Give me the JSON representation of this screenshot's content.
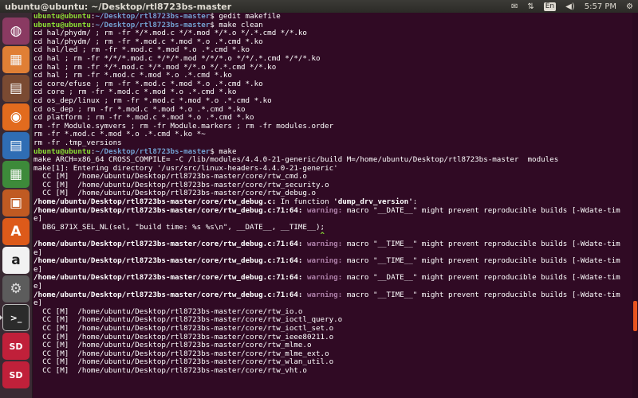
{
  "window": {
    "title": "ubuntu@ubuntu: ~/Desktop/rtl8723bs-master"
  },
  "panel": {
    "keyboard_layout": "En",
    "time": "5:57 PM"
  },
  "launcher": {
    "items": [
      {
        "name": "dash-home-icon",
        "color": "#ffffff",
        "bg": "#8a3a62",
        "glyph": "◍"
      },
      {
        "name": "system-installer-icon",
        "color": "#f6f6f6",
        "bg": "#e07f35",
        "glyph": "▦"
      },
      {
        "name": "files-icon",
        "color": "#ffffff",
        "bg": "#7a4a32",
        "glyph": "▤"
      },
      {
        "name": "firefox-icon",
        "color": "#ffffff",
        "bg": "#e26b1e",
        "glyph": "◉"
      },
      {
        "name": "libreoffice-writer-icon",
        "color": "#ffffff",
        "bg": "#2f6db4",
        "glyph": "▤"
      },
      {
        "name": "libreoffice-calc-icon",
        "color": "#ffffff",
        "bg": "#3d8a3a",
        "glyph": "▦"
      },
      {
        "name": "libreoffice-impress-icon",
        "color": "#ffffff",
        "bg": "#c05a22",
        "glyph": "▣"
      },
      {
        "name": "ubuntu-software-icon",
        "color": "#ffffff",
        "bg": "#dd5a1a",
        "glyph": "A"
      },
      {
        "name": "amazon-icon",
        "color": "#222222",
        "bg": "#f2f2f2",
        "glyph": "a"
      },
      {
        "name": "system-settings-icon",
        "color": "#dddddd",
        "bg": "#5c5c5c",
        "glyph": "⚙"
      },
      {
        "name": "terminal-icon",
        "color": "#ffffff",
        "bg": "#2b2b2b",
        "glyph": ">_"
      },
      {
        "name": "sd-card-icon",
        "color": "#ffffff",
        "bg": "#c0203a",
        "glyph": "SD"
      },
      {
        "name": "sd-card-icon-2",
        "color": "#ffffff",
        "bg": "#c0203a",
        "glyph": "SD"
      }
    ],
    "active_index": 10
  },
  "terminal": {
    "lines": [
      [
        {
          "t": "ubuntu@ubuntu",
          "c": "prompt"
        },
        {
          "t": ":",
          "c": ""
        },
        {
          "t": "~/Desktop/rtl8723bs-master",
          "c": "path"
        },
        {
          "t": "$ gedit makefile",
          "c": ""
        }
      ],
      [
        {
          "t": "ubuntu@ubuntu",
          "c": "prompt"
        },
        {
          "t": ":",
          "c": ""
        },
        {
          "t": "~/Desktop/rtl8723bs-master",
          "c": "path"
        },
        {
          "t": "$ make clean",
          "c": ""
        }
      ],
      [
        {
          "t": "cd hal/phydm/ ; rm -fr */*.mod.c */*.mod */*.o */.*.cmd */*.ko",
          "c": ""
        }
      ],
      [
        {
          "t": "cd hal/phydm/ ; rm -fr *.mod.c *.mod *.o .*.cmd *.ko",
          "c": ""
        }
      ],
      [
        {
          "t": "cd hal/led ; rm -fr *.mod.c *.mod *.o .*.cmd *.ko",
          "c": ""
        }
      ],
      [
        {
          "t": "cd hal ; rm -fr */*/*.mod.c */*/*.mod */*/*.o */*/.*.cmd */*/*.ko",
          "c": ""
        }
      ],
      [
        {
          "t": "cd hal ; rm -fr */*.mod.c */*.mod */*.o */.*.cmd */*.ko",
          "c": ""
        }
      ],
      [
        {
          "t": "cd hal ; rm -fr *.mod.c *.mod *.o .*.cmd *.ko",
          "c": ""
        }
      ],
      [
        {
          "t": "cd core/efuse ; rm -fr *.mod.c *.mod *.o .*.cmd *.ko",
          "c": ""
        }
      ],
      [
        {
          "t": "cd core ; rm -fr *.mod.c *.mod *.o .*.cmd *.ko",
          "c": ""
        }
      ],
      [
        {
          "t": "cd os_dep/linux ; rm -fr *.mod.c *.mod *.o .*.cmd *.ko",
          "c": ""
        }
      ],
      [
        {
          "t": "cd os_dep ; rm -fr *.mod.c *.mod *.o .*.cmd *.ko",
          "c": ""
        }
      ],
      [
        {
          "t": "cd platform ; rm -fr *.mod.c *.mod *.o .*.cmd *.ko",
          "c": ""
        }
      ],
      [
        {
          "t": "rm -fr Module.symvers ; rm -fr Module.markers ; rm -fr modules.order",
          "c": ""
        }
      ],
      [
        {
          "t": "rm -fr *.mod.c *.mod *.o .*.cmd *.ko *~",
          "c": ""
        }
      ],
      [
        {
          "t": "rm -fr .tmp_versions",
          "c": ""
        }
      ],
      [
        {
          "t": "ubuntu@ubuntu",
          "c": "prompt"
        },
        {
          "t": ":",
          "c": ""
        },
        {
          "t": "~/Desktop/rtl8723bs-master",
          "c": "path"
        },
        {
          "t": "$ make",
          "c": ""
        }
      ],
      [
        {
          "t": "make ARCH=x86_64 CROSS_COMPILE= -C /lib/modules/4.4.0-21-generic/build M=/home/ubuntu/Desktop/rtl8723bs-master  modules",
          "c": ""
        }
      ],
      [
        {
          "t": "make[1]: Entering directory '/usr/src/linux-headers-4.4.0-21-generic'",
          "c": ""
        }
      ],
      [
        {
          "t": "  CC [M]  /home/ubuntu/Desktop/rtl8723bs-master/core/rtw_cmd.o",
          "c": ""
        }
      ],
      [
        {
          "t": "  CC [M]  /home/ubuntu/Desktop/rtl8723bs-master/core/rtw_security.o",
          "c": ""
        }
      ],
      [
        {
          "t": "  CC [M]  /home/ubuntu/Desktop/rtl8723bs-master/core/rtw_debug.o",
          "c": ""
        }
      ],
      [
        {
          "t": "/home/ubuntu/Desktop/rtl8723bs-master/core/rtw_debug.c:",
          "c": "bold"
        },
        {
          "t": " In function ",
          "c": ""
        },
        {
          "t": "'dump_drv_version'",
          "c": "bold"
        },
        {
          "t": ":",
          "c": ""
        }
      ],
      [
        {
          "t": "/home/ubuntu/Desktop/rtl8723bs-master/core/rtw_debug.c:71:64:",
          "c": "bold"
        },
        {
          "t": " ",
          "c": ""
        },
        {
          "t": "warning:",
          "c": "warn"
        },
        {
          "t": " macro \"__DATE__\" might prevent reproducible builds [-Wdate-tim",
          "c": ""
        }
      ],
      [
        {
          "t": "e]",
          "c": ""
        }
      ],
      [
        {
          "t": "  DBG_871X_SEL_NL(sel, \"build time: %s %s\\n\", __DATE__, __TIME__);",
          "c": ""
        }
      ],
      [
        {
          "t": "                                                                 ",
          "c": ""
        },
        {
          "t": "^",
          "c": "green"
        }
      ],
      [
        {
          "t": "/home/ubuntu/Desktop/rtl8723bs-master/core/rtw_debug.c:71:64:",
          "c": "bold"
        },
        {
          "t": " ",
          "c": ""
        },
        {
          "t": "warning:",
          "c": "warn"
        },
        {
          "t": " macro \"__TIME__\" might prevent reproducible builds [-Wdate-tim",
          "c": ""
        }
      ],
      [
        {
          "t": "e]",
          "c": ""
        }
      ],
      [
        {
          "t": "/home/ubuntu/Desktop/rtl8723bs-master/core/rtw_debug.c:71:64:",
          "c": "bold"
        },
        {
          "t": " ",
          "c": ""
        },
        {
          "t": "warning:",
          "c": "warn"
        },
        {
          "t": " macro \"__TIME__\" might prevent reproducible builds [-Wdate-tim",
          "c": ""
        }
      ],
      [
        {
          "t": "e]",
          "c": ""
        }
      ],
      [
        {
          "t": "/home/ubuntu/Desktop/rtl8723bs-master/core/rtw_debug.c:71:64:",
          "c": "bold"
        },
        {
          "t": " ",
          "c": ""
        },
        {
          "t": "warning:",
          "c": "warn"
        },
        {
          "t": " macro \"__DATE__\" might prevent reproducible builds [-Wdate-tim",
          "c": ""
        }
      ],
      [
        {
          "t": "e]",
          "c": ""
        }
      ],
      [
        {
          "t": "/home/ubuntu/Desktop/rtl8723bs-master/core/rtw_debug.c:71:64:",
          "c": "bold"
        },
        {
          "t": " ",
          "c": ""
        },
        {
          "t": "warning:",
          "c": "warn"
        },
        {
          "t": " macro \"__TIME__\" might prevent reproducible builds [-Wdate-tim",
          "c": ""
        }
      ],
      [
        {
          "t": "e]",
          "c": ""
        }
      ],
      [
        {
          "t": "  CC [M]  /home/ubuntu/Desktop/rtl8723bs-master/core/rtw_io.o",
          "c": ""
        }
      ],
      [
        {
          "t": "  CC [M]  /home/ubuntu/Desktop/rtl8723bs-master/core/rtw_ioctl_query.o",
          "c": ""
        }
      ],
      [
        {
          "t": "  CC [M]  /home/ubuntu/Desktop/rtl8723bs-master/core/rtw_ioctl_set.o",
          "c": ""
        }
      ],
      [
        {
          "t": "  CC [M]  /home/ubuntu/Desktop/rtl8723bs-master/core/rtw_ieee80211.o",
          "c": ""
        }
      ],
      [
        {
          "t": "  CC [M]  /home/ubuntu/Desktop/rtl8723bs-master/core/rtw_mlme.o",
          "c": ""
        }
      ],
      [
        {
          "t": "  CC [M]  /home/ubuntu/Desktop/rtl8723bs-master/core/rtw_mlme_ext.o",
          "c": ""
        }
      ],
      [
        {
          "t": "  CC [M]  /home/ubuntu/Desktop/rtl8723bs-master/core/rtw_wlan_util.o",
          "c": ""
        }
      ],
      [
        {
          "t": "  CC [M]  /home/ubuntu/Desktop/rtl8723bs-master/core/rtw_vht.o",
          "c": ""
        }
      ]
    ]
  }
}
